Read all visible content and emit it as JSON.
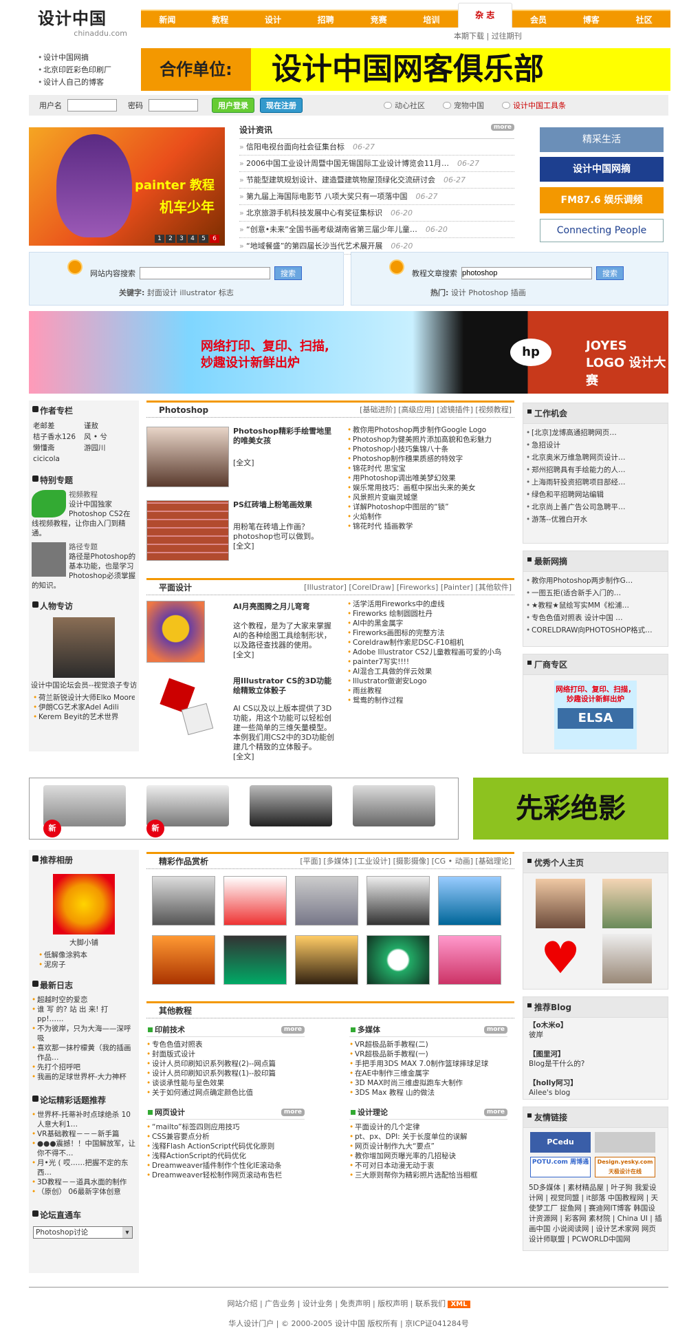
{
  "header": {
    "logo_cn": "设计中国",
    "logo_en": "chinaddu.com",
    "quick": [
      "设计中国网摘",
      "北京印匠彩色印刷厂",
      "设计人自己的博客"
    ],
    "nav": [
      "新闻",
      "教程",
      "设计",
      "招聘",
      "竞赛",
      "培训",
      "杂 志",
      "会员",
      "博客",
      "社区"
    ],
    "nav_selected": "杂 志",
    "sub": "本期下载 | 过往期刊",
    "ad_left": "合作单位:",
    "ad_right": "设计中国网客俱乐部"
  },
  "login": {
    "user_label": "用户名",
    "pass_label": "密码",
    "login_btn": "用户登录",
    "reg_btn": "现在注册",
    "opt1": "动心社区",
    "opt2": "宠物中国",
    "opt3": "设计中国工具条"
  },
  "hero": {
    "title": "painter 教程",
    "subtitle": "机车少年",
    "pages": [
      "1",
      "2",
      "3",
      "4",
      "5",
      "6"
    ]
  },
  "news": {
    "title": "设计资讯",
    "more": "more",
    "items": [
      {
        "t": "信阳电视台面向社会征集台标",
        "d": "06-27"
      },
      {
        "t": "2006中国工业设计周暨中国无锡国际工业设计博览会11月…",
        "d": "06-27"
      },
      {
        "t": "节能型建筑规划设计、建造暨建筑物屋顶绿化交流研讨会",
        "d": "06-27"
      },
      {
        "t": "第九届上海国际电影节 八项大奖只有一项落中国",
        "d": "06-27"
      },
      {
        "t": "北京旅游手机科技发展中心有奖征集标识",
        "d": "06-20"
      },
      {
        "t": "“创意•未来”全国书画考级湖南省第三届少年儿童…",
        "d": "06-20"
      },
      {
        "t": "“地域餐盛”的第四届长沙当代艺术展开展",
        "d": "06-20"
      }
    ]
  },
  "right_ads": [
    "精采生活",
    "设计中国网摘",
    "FM87.6 娱乐调频",
    "Connecting People"
  ],
  "search1": {
    "label": "网站内容搜索",
    "btn": "搜索",
    "kw_label": "关键字:",
    "kw": "封面设计 illustrator 标志"
  },
  "search2": {
    "label": "教程文章搜索",
    "value": "photoshop",
    "btn": "搜索",
    "kw_label": "热门:",
    "kw": "设计 Photoshop 插画"
  },
  "banner2": {
    "text1": "网络打印、复印、扫描,",
    "text2": "妙趣设计新鲜出炉",
    "hp": "hp",
    "joyes": "JOYES LOGO 设计大赛"
  },
  "author": {
    "title": "作者专栏",
    "names": [
      "老邮差",
      "谨敖",
      "桔子香水126",
      "风 • 兮",
      "懒懂斋",
      "游园川",
      "cicicola"
    ]
  },
  "special": {
    "title": "特别专题",
    "s1_title": "视频教程",
    "s1_desc": "设计中国独家Photoshop CS2在线视频教程，让你由入门到精通。",
    "s2_title": "路径专题",
    "s2_desc": "路径是Photoshop的基本功能，也是学习Photoshop必须掌握的知识。"
  },
  "people": {
    "title": "人物专访",
    "caption": "设计中国论坛会员--视觉浪子专访",
    "items": [
      "荷兰新锐设计大师Elko Moorer",
      "伊朗CG艺术家Adel Adili",
      "Kerem Beyit的艺术世界"
    ]
  },
  "ps": {
    "title": "Photoshop",
    "tabs": "[基础进阶] [高级应用] [滤镜插件] [视频教程]",
    "a1_title": "Photoshop精彩手绘雪地里的唯美女孩",
    "a1_more": "[全文]",
    "a2_title": "PS红砖墙上粉笔画效果",
    "a2_desc": "用粉笔在砖墙上作画？photoshop也可以做到。",
    "a2_more": "[全文]",
    "list": [
      "教你用Photoshop两步制作Google Logo",
      "Photoshop为健美照片添加高貌和色彩魅力",
      "Photoshop小技巧集锦八十条",
      "Photoshop制作穗果质感的特效字",
      "锦花时代 思宝宝",
      "用Photoshop调出唯美梦幻效果",
      "娱乐常用技巧：画框中探出头来的美女",
      "风景照片变幽灵城堡",
      "详解Photoshop中图层的“锁”",
      "火焰制作",
      "锦花时代 插画教学"
    ]
  },
  "pm": {
    "title": "平面设计",
    "tabs": "[Illustrator] [CorelDraw] [Fireworks] [Painter] [其他软件]",
    "a1_title": "AI月亮图腾之月儿弯弯",
    "a1_desc": "这个教程，是为了大家来掌握AI的各种绘图工具绘制形状，以及路径查找器的使用。",
    "a1_more": "[全文]",
    "a2_title": "用Illustrator CS的3D功能绘精致立体骰子",
    "a2_desc": "AI CS以及以上版本提供了3D功能，用这个功能可以轻松创建一些简单的三维矢量模型。本例我们用CS2中的3D功能创建几个精致的立体骰子。",
    "a2_more": "[全文]",
    "list": [
      "活学活用Fireworks中的虚线",
      "Fireworks 绘制圆圆杜丹",
      "AI中的黑金属字",
      "Fireworks画图标的完整方法",
      "Coreldraw制作索尼DSC-F10相机",
      "Adobe Illustrator CS2儿童教程画可爱的小鸟",
      "painter7写实!!!!",
      "AI混合工具做的伴云效果",
      "Illustrator做谢安Logo",
      "雨丝教程",
      "鸳鸯的制作过程"
    ]
  },
  "jobs": {
    "title": "工作机会",
    "items": [
      "[北京]龙博高通招聘网页…",
      "急招设计",
      "北京奥米万维急聘网页设计…",
      "郑州招聘具有手绘能力的人…",
      "上海雨轩投资招聘项目部经…",
      "绿色和平招聘网站编辑",
      "北京尚上善广告公司急聘平…",
      "游荡--优雅白开水"
    ]
  },
  "newest": {
    "title": "最新网摘",
    "items": [
      "教你用Photoshop两步制作G…",
      "一图五拒(适合新手入门的…",
      "★教程★鼠绘写实MM《松浦…",
      "专色色值对照表 设计中国 …",
      "CORELDRAW向PHOTOSHOP格式…"
    ]
  },
  "vendor": {
    "title": "厂商专区",
    "text": "网络打印、复印、扫描，妙趣设计新鲜出炉",
    "logo": "ELSA"
  },
  "printer_banner": {
    "tag": "新",
    "right": "先彩绝影"
  },
  "album": {
    "title": "推荐相册",
    "caption": "大脚小铺",
    "items": [
      "低解像涂鸦本",
      "泥房子"
    ]
  },
  "diary": {
    "title": "最新日志",
    "items": [
      "超越时空的爱恋",
      "谁 写 的? 站 出 来! 打 pp!……",
      "不为彼岸，只为大海——深呼吸",
      "喜欢那一抹柠檬黄（我的插画作品…",
      "先打个招呼吧",
      "我画的足球世界杯-大力神杯"
    ]
  },
  "topic": {
    "title": "论坛精彩话题推荐",
    "items": [
      "世界杯-托蒂补时点球绝杀 10人意大利1…",
      "VR基础教程－－－新手篇",
      "●●●震撼！！中国解放军，让你不得不…",
      "月•光 ( 哎……把握不定的东西…",
      "3D教程－－道具水面的制作",
      "（原创） 06最新字体创意"
    ]
  },
  "direct": {
    "title": "论坛直通车",
    "select": "Photoshop讨论"
  },
  "works": {
    "title": "精彩作品赏析",
    "tabs": "[平面] [多媒体] [工业设计] [摄影摄像] [CG • 动画] [基础理论]"
  },
  "other": {
    "title": "其他教程",
    "g1": {
      "title": "印前技术",
      "items": [
        "专色色值对照表",
        "封面版式设计",
        "设计人员印刷知识系列教程(2)--网点篇",
        "设计人员印刷知识系列教程(1)--胶印篇",
        "谈谈承性能与呈色效果",
        "关于如何通过网点确定颜色比值"
      ]
    },
    "g2": {
      "title": "多媒体",
      "items": [
        "VR超极品新手教程(二)",
        "VR超极品新手教程(一)",
        "手把手用3DS MAX 7.0制作篮球摔球足球",
        "在AE中制作三维金属字",
        "3D MAX时尚三维虚拟跑车大制作",
        "3DS Max 教程 山的做法"
      ]
    },
    "g3": {
      "title": "网页设计",
      "items": [
        "“mailto”标签四则应用技巧",
        "CSS兼容要点分析",
        "浅释Flash ActionScript代码优化原则",
        "浅释ActionScript的代码优化",
        "Dreamweaver插件制作个性化IE滚动条",
        "Dreamweaver轻松制作网页滚动布告栏"
      ]
    },
    "g4": {
      "title": "设计理论",
      "items": [
        "平面设计的几个定律",
        "pt、px、DPI: 关于长度单位的误解",
        "网页设计制作九大“要点”",
        "教你增加网页曝光率的几招秘诀",
        "不可对日本动漫无动于衷",
        "三大原则帮你为精彩照片选配恰当相框"
      ]
    }
  },
  "personal": {
    "title": "优秀个人主页"
  },
  "blog": {
    "title": "推荐Blog",
    "b1": "【o木米o】",
    "b1d": "彼岸",
    "b2": "【图里河】",
    "b2d": "Blog是干什么的?",
    "b3": "【holly阿习】",
    "b3d": "Ailee's blog"
  },
  "links": {
    "title": "友情链接",
    "logo1": "PCedu",
    "logo2": "POTU.com 周博通",
    "logo3": "Design.yesky.com 天极设计在线",
    "text": "5D多媒体 | 素材精品屋 | 叶子狗 我爱设计网 | 视觉同盟 | it部落 中国教程网 | 天使梦工厂 捉鱼网 | 赛迪网IT博客 韩国设计资源网 | 彩客网 素材院 | China UI | 插画中国 小说阅读网 | 设计艺术家网 网页设计师联盟 | PCWORLD中国网"
  },
  "footer": {
    "links": "网站介绍  |  广告业务  |  设计业务  |  免责声明  |  版权声明  |  联系我们",
    "xml": "XML",
    "copy": "华人设计门户  |  © 2000-2005 设计中国 版权所有  |  京ICP证041284号"
  }
}
